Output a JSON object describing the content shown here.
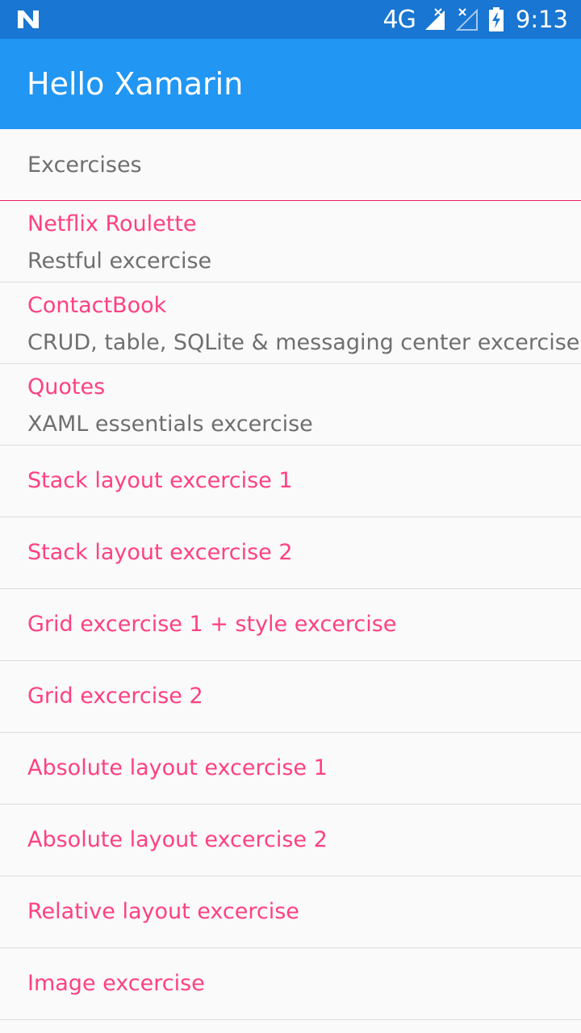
{
  "status_bar": {
    "app_icon": "n-notification-icon",
    "network_label": "4G",
    "time": "9:13",
    "colors": {
      "background": "#1976d2"
    }
  },
  "app_bar": {
    "title": "Hello Xamarin",
    "colors": {
      "background": "#2196f3"
    }
  },
  "list": {
    "header": "Excercises",
    "items": [
      {
        "title": "Netflix Roulette",
        "detail": "Restful excercise"
      },
      {
        "title": "ContactBook",
        "detail": "CRUD, table, SQLite & messaging center excercise"
      },
      {
        "title": "Quotes",
        "detail": "XAML essentials excercise"
      },
      {
        "title": "Stack layout excercise 1"
      },
      {
        "title": "Stack layout excercise 2"
      },
      {
        "title": "Grid excercise 1 + style excercise"
      },
      {
        "title": "Grid excercise 2"
      },
      {
        "title": "Absolute layout excercise 1"
      },
      {
        "title": "Absolute layout excercise 2"
      },
      {
        "title": "Relative layout excercise"
      },
      {
        "title": "Image excercise"
      }
    ]
  },
  "colors": {
    "accent": "#ff4081",
    "secondary_text": "#6f6f6f",
    "divider": "#dcdcdc",
    "header_divider": "#e91e63"
  }
}
